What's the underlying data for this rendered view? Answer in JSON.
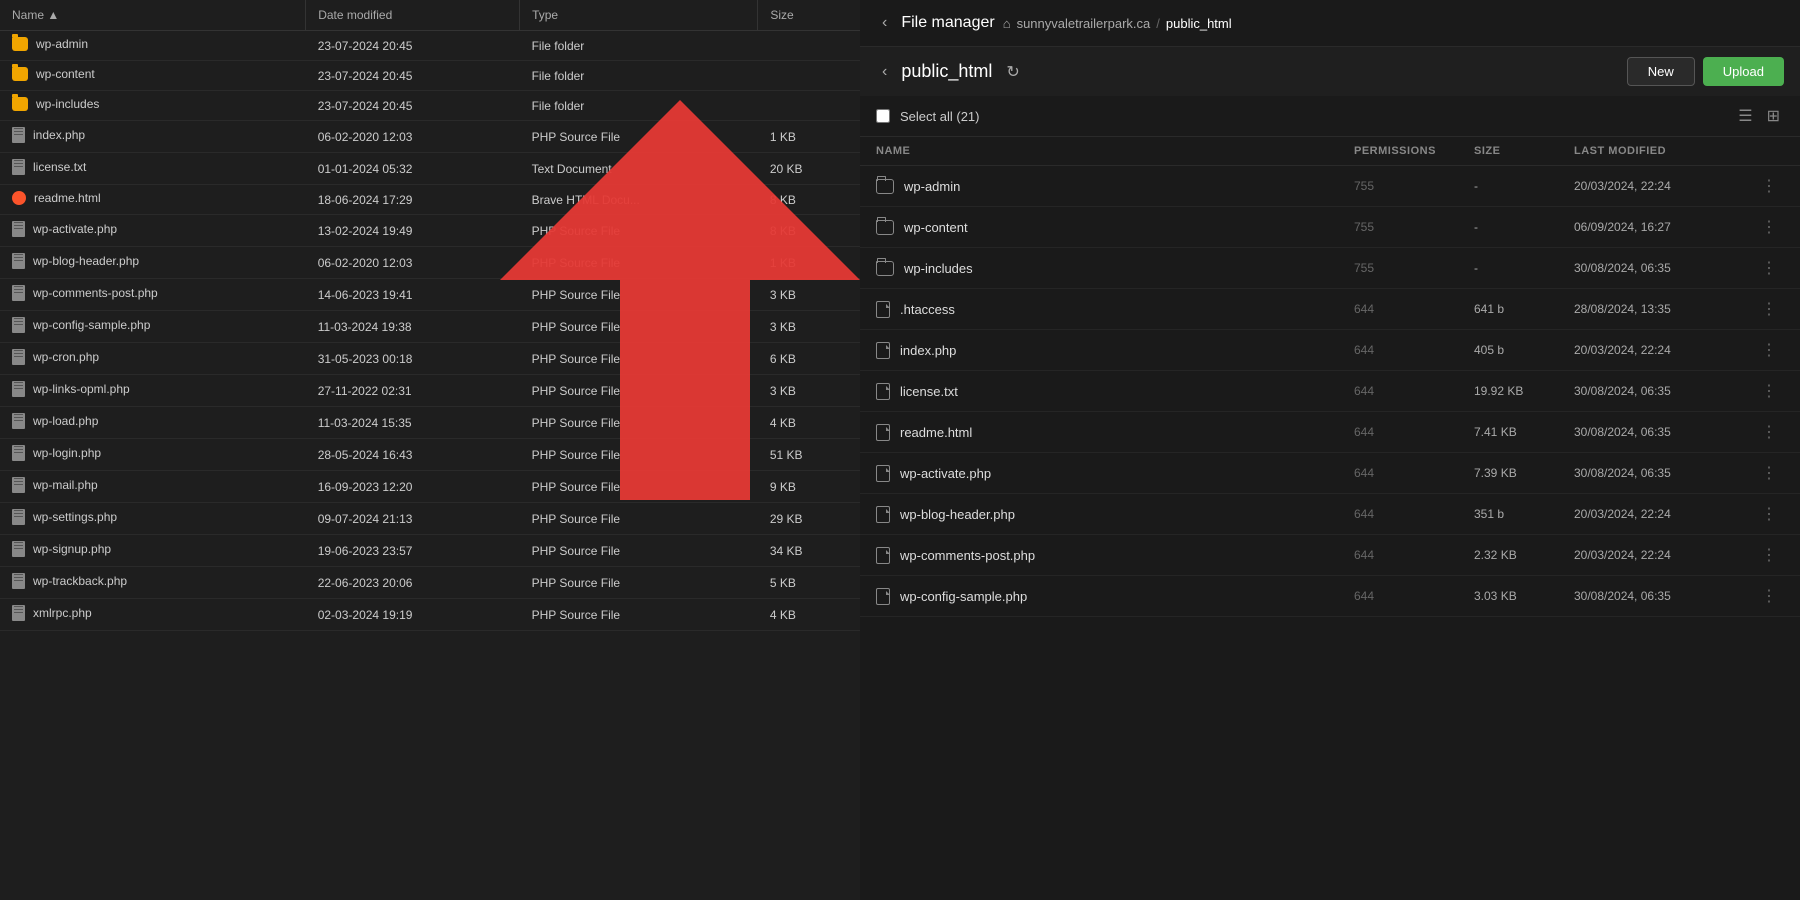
{
  "leftPanel": {
    "columns": [
      "Name",
      "Date modified",
      "Type",
      "Size"
    ],
    "files": [
      {
        "name": "wp-admin",
        "type": "folder",
        "dateModified": "23-07-2024 20:45",
        "fileType": "File folder",
        "size": ""
      },
      {
        "name": "wp-content",
        "type": "folder",
        "dateModified": "23-07-2024 20:45",
        "fileType": "File folder",
        "size": ""
      },
      {
        "name": "wp-includes",
        "type": "folder",
        "dateModified": "23-07-2024 20:45",
        "fileType": "File folder",
        "size": ""
      },
      {
        "name": "index.php",
        "type": "file",
        "dateModified": "06-02-2020 12:03",
        "fileType": "PHP Source File",
        "size": "1 KB"
      },
      {
        "name": "license.txt",
        "type": "file",
        "dateModified": "01-01-2024 05:32",
        "fileType": "Text Document",
        "size": "20 KB"
      },
      {
        "name": "readme.html",
        "type": "brave",
        "dateModified": "18-06-2024 17:29",
        "fileType": "Brave HTML Docu...",
        "size": "8 KB"
      },
      {
        "name": "wp-activate.php",
        "type": "file",
        "dateModified": "13-02-2024 19:49",
        "fileType": "PHP Source File",
        "size": "8 KB"
      },
      {
        "name": "wp-blog-header.php",
        "type": "file",
        "dateModified": "06-02-2020 12:03",
        "fileType": "PHP Source File",
        "size": "1 KB"
      },
      {
        "name": "wp-comments-post.php",
        "type": "file",
        "dateModified": "14-06-2023 19:41",
        "fileType": "PHP Source File",
        "size": "3 KB"
      },
      {
        "name": "wp-config-sample.php",
        "type": "file",
        "dateModified": "11-03-2024 19:38",
        "fileType": "PHP Source File",
        "size": "3 KB"
      },
      {
        "name": "wp-cron.php",
        "type": "file",
        "dateModified": "31-05-2023 00:18",
        "fileType": "PHP Source File",
        "size": "6 KB"
      },
      {
        "name": "wp-links-opml.php",
        "type": "file",
        "dateModified": "27-11-2022 02:31",
        "fileType": "PHP Source File",
        "size": "3 KB"
      },
      {
        "name": "wp-load.php",
        "type": "file",
        "dateModified": "11-03-2024 15:35",
        "fileType": "PHP Source File",
        "size": "4 KB"
      },
      {
        "name": "wp-login.php",
        "type": "file",
        "dateModified": "28-05-2024 16:43",
        "fileType": "PHP Source File",
        "size": "51 KB"
      },
      {
        "name": "wp-mail.php",
        "type": "file",
        "dateModified": "16-09-2023 12:20",
        "fileType": "PHP Source File",
        "size": "9 KB"
      },
      {
        "name": "wp-settings.php",
        "type": "file",
        "dateModified": "09-07-2024 21:13",
        "fileType": "PHP Source File",
        "size": "29 KB"
      },
      {
        "name": "wp-signup.php",
        "type": "file",
        "dateModified": "19-06-2023 23:57",
        "fileType": "PHP Source File",
        "size": "34 KB"
      },
      {
        "name": "wp-trackback.php",
        "type": "file",
        "dateModified": "22-06-2023 20:06",
        "fileType": "PHP Source File",
        "size": "5 KB"
      },
      {
        "name": "xmlrpc.php",
        "type": "file",
        "dateModified": "02-03-2024 19:19",
        "fileType": "PHP Source File",
        "size": "4 KB"
      }
    ]
  },
  "rightPanel": {
    "nav": {
      "backLabel": "‹",
      "title": "File manager",
      "homeIcon": "⌂",
      "breadcrumb": [
        "sunnyvaletrailerpark.ca",
        "/",
        "public_html"
      ]
    },
    "toolbar": {
      "backLabel": "‹",
      "folderName": "public_html",
      "refreshIcon": "↻",
      "newLabel": "New",
      "uploadLabel": "Upload"
    },
    "selectBar": {
      "label": "Select all (21)"
    },
    "columns": {
      "name": "NAME",
      "permissions": "PERMISSIONS",
      "size": "SIZE",
      "lastModified": "LAST MODIFIED"
    },
    "files": [
      {
        "name": "wp-admin",
        "type": "folder",
        "permissions": "755",
        "size": "-",
        "lastModified": "20/03/2024, 22:24"
      },
      {
        "name": "wp-content",
        "type": "folder",
        "permissions": "755",
        "size": "-",
        "lastModified": "06/09/2024, 16:27"
      },
      {
        "name": "wp-includes",
        "type": "folder",
        "permissions": "755",
        "size": "-",
        "lastModified": "30/08/2024, 06:35"
      },
      {
        "name": ".htaccess",
        "type": "file",
        "permissions": "644",
        "size": "641 b",
        "lastModified": "28/08/2024, 13:35"
      },
      {
        "name": "index.php",
        "type": "file",
        "permissions": "644",
        "size": "405 b",
        "lastModified": "20/03/2024, 22:24"
      },
      {
        "name": "license.txt",
        "type": "file",
        "permissions": "644",
        "size": "19.92 KB",
        "lastModified": "30/08/2024, 06:35"
      },
      {
        "name": "readme.html",
        "type": "file",
        "permissions": "644",
        "size": "7.41 KB",
        "lastModified": "30/08/2024, 06:35"
      },
      {
        "name": "wp-activate.php",
        "type": "file",
        "permissions": "644",
        "size": "7.39 KB",
        "lastModified": "30/08/2024, 06:35"
      },
      {
        "name": "wp-blog-header.php",
        "type": "file",
        "permissions": "644",
        "size": "351 b",
        "lastModified": "20/03/2024, 22:24"
      },
      {
        "name": "wp-comments-post.php",
        "type": "file",
        "permissions": "644",
        "size": "2.32 KB",
        "lastModified": "20/03/2024, 22:24"
      },
      {
        "name": "wp-config-sample.php",
        "type": "file",
        "permissions": "644",
        "size": "3.03 KB",
        "lastModified": "30/08/2024, 06:35"
      }
    ]
  }
}
